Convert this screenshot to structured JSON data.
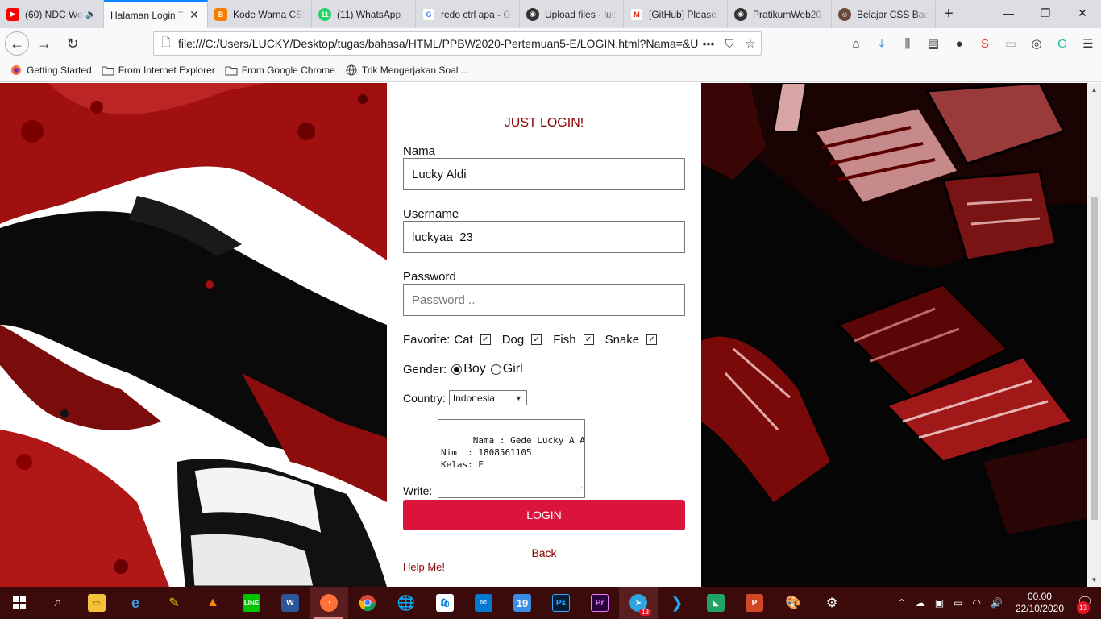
{
  "browser": {
    "tabs": [
      {
        "title": "(60) NDC Wo",
        "favicon": "youtube-icon",
        "color": "#ff0000",
        "audio": true,
        "active": false
      },
      {
        "title": "Halaman Login T",
        "favicon": "",
        "color": "",
        "audio": false,
        "active": true
      },
      {
        "title": "Kode Warna CSS",
        "favicon": "blogger-icon",
        "color": "#f57d00",
        "audio": false,
        "active": false
      },
      {
        "title": "(11) WhatsApp",
        "favicon": "whatsapp-icon",
        "color": "#25d366",
        "audio": false,
        "active": false
      },
      {
        "title": "redo ctrl apa - G",
        "favicon": "google-icon",
        "color": "#4285f4",
        "audio": false,
        "active": false
      },
      {
        "title": "Upload files · luc",
        "favicon": "github-icon",
        "color": "#333333",
        "audio": false,
        "active": false
      },
      {
        "title": "[GitHub] Please",
        "favicon": "gmail-icon",
        "color": "#d93025",
        "audio": false,
        "active": false
      },
      {
        "title": "PratikumWeb20",
        "favicon": "github-icon",
        "color": "#333333",
        "audio": false,
        "active": false
      },
      {
        "title": "Belajar CSS Back",
        "favicon": "avatar-icon",
        "color": "#6b4a3a",
        "audio": false,
        "active": false
      }
    ],
    "whatsapp_badge": "11",
    "url": "file:///C:/Users/LUCKY/Desktop/tugas/bahasa/HTML/PPBW2020-Pertemuan5-E/LOGIN.html?Nama=&U",
    "bookmarks": [
      {
        "label": "Getting Started",
        "icon": "firefox-icon"
      },
      {
        "label": "From Internet Explorer",
        "icon": "folder-icon"
      },
      {
        "label": "From Google Chrome",
        "icon": "folder-icon"
      },
      {
        "label": "Trik Mengerjakan Soal ...",
        "icon": "globe-icon"
      }
    ]
  },
  "page": {
    "heading": "JUST LOGIN!",
    "nama": {
      "label": "Nama",
      "value": "Lucky Aldi"
    },
    "username": {
      "label": "Username",
      "value": "luckyaa_23"
    },
    "password": {
      "label": "Password",
      "placeholder": "Password .."
    },
    "favorite": {
      "label": "Favorite:",
      "options": [
        {
          "label": "Cat",
          "checked": true
        },
        {
          "label": "Dog",
          "checked": true
        },
        {
          "label": "Fish",
          "checked": true
        },
        {
          "label": "Snake",
          "checked": true
        }
      ]
    },
    "gender": {
      "label": "Gender:",
      "options": [
        {
          "label": "Boy",
          "checked": true
        },
        {
          "label": "Girl",
          "checked": false
        }
      ]
    },
    "country": {
      "label": "Country:",
      "value": "Indonesia"
    },
    "write": {
      "label": "Write:",
      "value": "Nama : Gede Lucky A A\nNim  : 1808561105\nKelas: E"
    },
    "login_button": "LOGIN",
    "back_link": "Back",
    "help_link": "Help Me!",
    "colors": {
      "accent": "#dc143c",
      "link": "#8b0000",
      "art_red": "#9b0f0f"
    }
  },
  "taskbar": {
    "apps": [
      "file-explorer-icon",
      "edge-icon",
      "sketch-tool-icon",
      "vlc-icon",
      "line-icon",
      "word-icon",
      "firefox-icon",
      "chrome-icon",
      "globe-app-icon",
      "store-icon",
      "mail-icon",
      "app-19-icon",
      "photoshop-icon",
      "premiere-icon",
      "telegram-icon",
      "vscode-icon",
      "green-app-icon",
      "powerpoint-icon",
      "paint-icon",
      "settings-icon"
    ],
    "telegram_badge": "13",
    "time": "00.00",
    "date": "22/10/2020",
    "notifications": "13"
  }
}
